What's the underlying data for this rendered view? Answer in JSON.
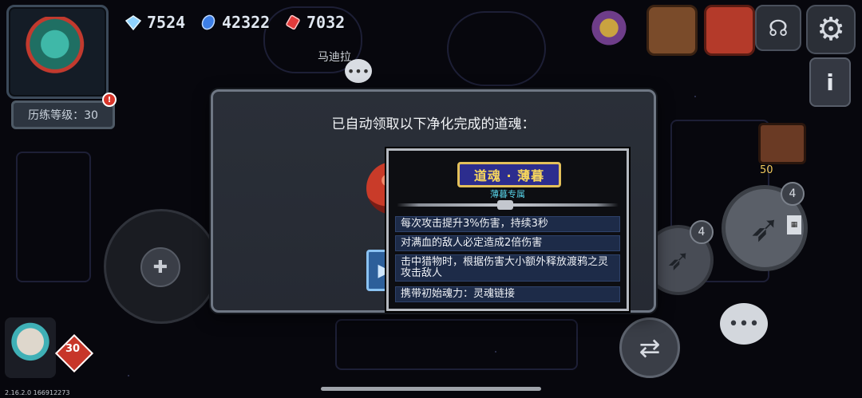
{
  "currencies": {
    "gems": {
      "value": "7524",
      "icon": "diamond-icon",
      "color": "#8fd3ff"
    },
    "blue_stones": {
      "value": "42322",
      "icon": "blue-crystal-icon",
      "color": "#3d7fe6"
    },
    "red_stones": {
      "value": "7032",
      "icon": "red-gem-icon",
      "color": "#e23b3b"
    }
  },
  "player": {
    "level_label": "历练等级：30",
    "alert": "!"
  },
  "npc": {
    "name": "马迪拉"
  },
  "dialog": {
    "title": "已自动领取以下净化完成的道魂："
  },
  "tooltip": {
    "name": "道魂 · 薄暮",
    "subtitle": "薄暮专属",
    "effects": [
      "每次攻击提升3%伤害，持续3秒",
      "对满血的敌人必定造成2倍伤害",
      "击中猎物时，根据伤害大小额外释放渡鸦之灵攻击敌人",
      "携带初始魂力：灵魂链接"
    ]
  },
  "right_hud": {
    "coin_count": "50",
    "skill_big_charges": "4",
    "skill_mid_charges": "4"
  },
  "pet": {
    "level": "30"
  },
  "version": "2.16.2.0 166912273"
}
